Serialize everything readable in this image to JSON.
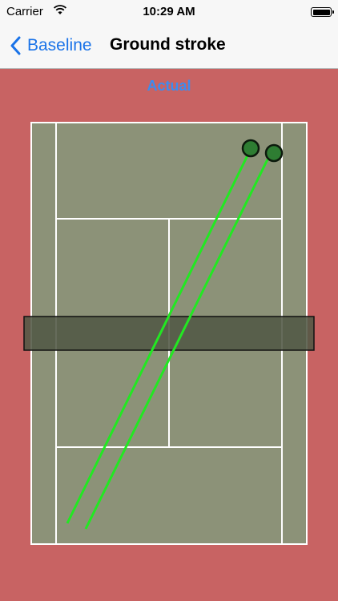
{
  "status_bar": {
    "carrier": "Carrier",
    "time": "10:29 AM"
  },
  "nav": {
    "back_label": "Baseline",
    "title": "Ground stroke"
  },
  "mode_label": "Actual",
  "colors": {
    "background": "#c86363",
    "court": "#8c9278",
    "net_band": "#515844",
    "trajectory": "#22e822",
    "ball": "#2e7d32",
    "link": "#1a73e8"
  },
  "trajectories": [
    {
      "name": "shot-1"
    },
    {
      "name": "shot-2"
    }
  ]
}
